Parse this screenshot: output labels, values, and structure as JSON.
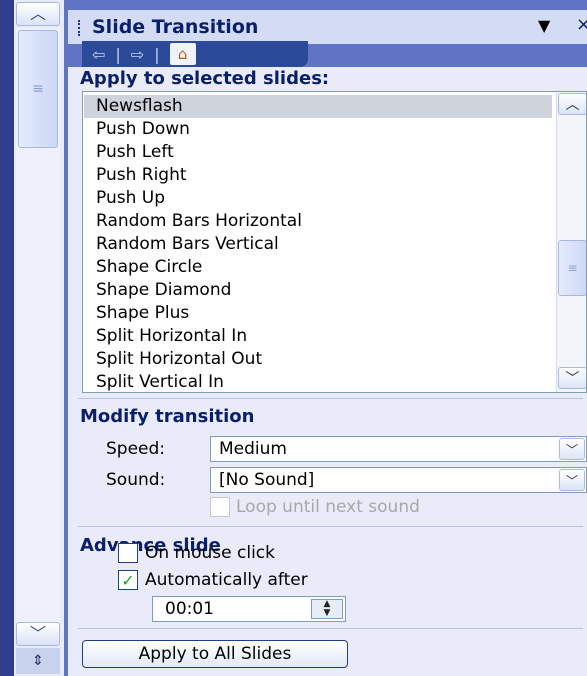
{
  "left_scrollbar": {
    "up_arrow": "︿",
    "down_arrow": "﹀",
    "thumb_grip": "≡",
    "split_arrows": "⇕"
  },
  "pane": {
    "title": "Slide Transition",
    "menu_arrow": "▼",
    "close_glyph": "×",
    "nav": {
      "back": "⇦",
      "forward": "⇨",
      "home": "⌂",
      "separator": "|"
    }
  },
  "apply_section": {
    "label": "Apply to selected slides:",
    "selected": "Newsflash",
    "items": [
      "Newsflash",
      "Push Down",
      "Push Left",
      "Push Right",
      "Push Up",
      "Random Bars Horizontal",
      "Random Bars Vertical",
      "Shape Circle",
      "Shape Diamond",
      "Shape Plus",
      "Split Horizontal In",
      "Split Horizontal Out",
      "Split Vertical In"
    ],
    "scroll_up": "︿",
    "scroll_down": "﹀",
    "thumb_grip": "≡"
  },
  "modify": {
    "label": "Modify transition",
    "speed_label": "Speed:",
    "speed_value": "Medium",
    "sound_label": "Sound:",
    "sound_value": "[No Sound]",
    "dropdown_glyph": "﹀",
    "loop_label": "Loop until next sound",
    "loop_checked": false
  },
  "advance": {
    "label": "Advance slide",
    "mouse_click_label": "On mouse click",
    "mouse_click_checked": false,
    "auto_label": "Automatically after",
    "auto_checked": true,
    "check_glyph": "✓",
    "time_value": "00:01",
    "spin_up": "▲",
    "spin_down": "▼"
  },
  "apply_all_label": "Apply to All Slides",
  "colors": {
    "pane_blue": "#6074c4",
    "header": "#d4dcf4",
    "title_text": "#0a1f6a",
    "body": "#e9ecf8",
    "check_green": "#22a022"
  }
}
